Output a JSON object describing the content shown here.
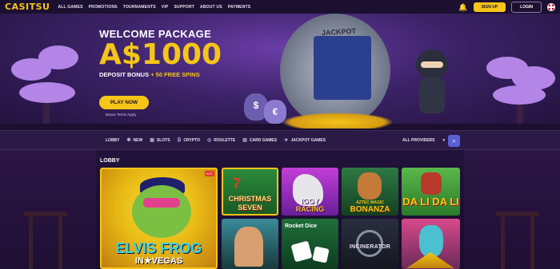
{
  "brand": {
    "logo": "CASITSU"
  },
  "nav": {
    "links": [
      "ALL GAMES",
      "PROMOTIONS",
      "TOURNAMENTS",
      "VIP",
      "SUPPORT",
      "ABOUT US",
      "PAYMENTS"
    ],
    "signup_label": "SIGN UP",
    "login_label": "LOGIN",
    "bell_icon": "bell-icon",
    "flag_icon": "uk-flag-icon"
  },
  "hero": {
    "headline": "WELCOME PACKAGE",
    "amount": "A$1000",
    "bonus_prefix": "DEPOSIT BONUS",
    "bonus_plus": "+",
    "bonus_spins": "50 FREE SPINS",
    "cta_label": "PLAY NOW",
    "terms": "Bonus Terms Apply",
    "vault_label": "JACKPOT"
  },
  "categories": {
    "items": [
      {
        "label": "LOBBY",
        "icon": ""
      },
      {
        "label": "NEW",
        "icon": "✺"
      },
      {
        "label": "SLOTS",
        "icon": "▣"
      },
      {
        "label": "CRYPTO",
        "icon": "₿"
      },
      {
        "label": "ROULETTE",
        "icon": "◎"
      },
      {
        "label": "CARD GAMES",
        "icon": "▤"
      },
      {
        "label": "JACKPOT GAMES",
        "icon": "★"
      }
    ],
    "providers_label": "ALL PROVIDERS",
    "search_icon": "search-icon"
  },
  "lobby": {
    "title": "LOBBY",
    "featured": {
      "name_line1": "ELVIS FROG",
      "name_line2": "IN★VEGAS",
      "badge": "HOT"
    },
    "games": [
      {
        "line1": "CHRISTMAS",
        "line2": "SEVEN",
        "top": "7"
      },
      {
        "line1": "IGGY",
        "line2": "RACING"
      },
      {
        "line1": "AZTEC MAGIC",
        "line2": "BONANZA"
      },
      {
        "line1": "DA LI DA LI"
      },
      {
        "line1": ""
      },
      {
        "line1": "Rocket Dice"
      },
      {
        "line1": "INCINERATOR"
      },
      {
        "line1": ""
      }
    ]
  },
  "colors": {
    "accent": "#f5c518",
    "background": "#24143b",
    "search": "#5b5fd6"
  }
}
